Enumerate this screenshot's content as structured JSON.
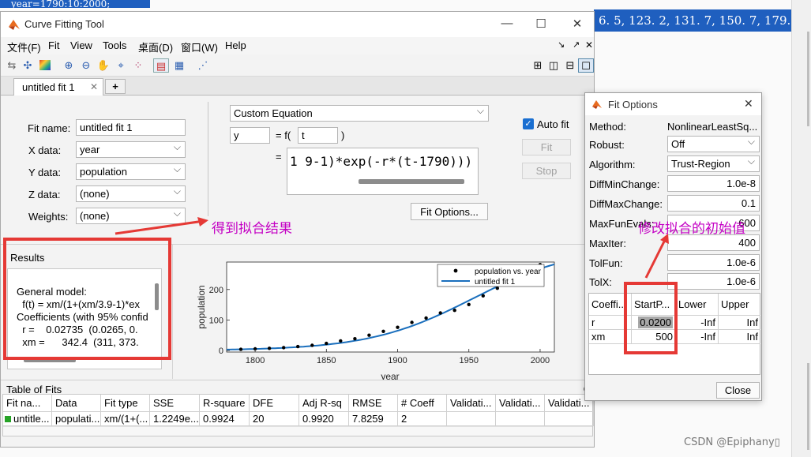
{
  "background": {
    "line1": "year=1790:10:2000;",
    "line2": "6. 5, 123. 2, 131. 7, 150. 7, 179."
  },
  "window": {
    "title": "Curve Fitting Tool",
    "menu": [
      "文件(F)",
      "Fit",
      "View",
      "Tools",
      "桌面(D)",
      "窗口(W)",
      "Help"
    ],
    "tab_label": "untitled fit 1",
    "tab_add": "+"
  },
  "fit_form": {
    "fit_name_label": "Fit name:",
    "fit_name_value": "untitled fit 1",
    "x_label": "X data:",
    "x_value": "year",
    "y_label": "Y data:",
    "y_value": "population",
    "z_label": "Z data:",
    "z_value": "(none)",
    "w_label": "Weights:",
    "w_value": "(none)"
  },
  "equation": {
    "type": "Custom Equation",
    "lhs": "y",
    "eq_sign": "= f(",
    "var": "t",
    "close": ")",
    "eq2": "=",
    "expr": "1 9-1)*exp(-r*(t-1790)))",
    "auto_fit": "Auto fit",
    "fit_btn": "Fit",
    "stop_btn": "Stop",
    "fit_options_btn": "Fit Options..."
  },
  "results": {
    "header": "Results",
    "lines": [
      "General model:",
      "  f(t) = xm/(1+(xm/3.9-1)*ex",
      "Coefficients (with 95% confid",
      "  r =    0.02735  (0.0265, 0.",
      "  xm =      342.4  (311, 373."
    ]
  },
  "chart_data": {
    "type": "scatter",
    "x": [
      1790,
      1800,
      1810,
      1820,
      1830,
      1840,
      1850,
      1860,
      1870,
      1880,
      1890,
      1900,
      1910,
      1920,
      1930,
      1940,
      1950,
      1960,
      1970,
      1980,
      1990,
      2000
    ],
    "series": [
      {
        "name": "population vs. year",
        "values": [
          3.9,
          5.3,
          7.2,
          9.6,
          12.9,
          17.1,
          23.2,
          31.4,
          38.6,
          50.2,
          62.9,
          76.0,
          92.0,
          106.5,
          123.2,
          131.7,
          150.7,
          179.3,
          204.0,
          226.5,
          251.4,
          281.4
        ]
      },
      {
        "name": "untitled fit 1",
        "model": "xm/(1+(xm/3.9-1)*exp(-r*(t-1790)))",
        "r": 0.02735,
        "xm": 342.4
      }
    ],
    "xlabel": "year",
    "ylabel": "population",
    "xticks": [
      1800,
      1850,
      1900,
      1950,
      2000
    ],
    "yticks": [
      0,
      100,
      200
    ],
    "xlim": [
      1780,
      2010
    ],
    "ylim": [
      -5,
      290
    ],
    "legend": "top-right"
  },
  "table_of_fits": {
    "title": "Table of Fits",
    "columns": [
      "Fit na...",
      "Data",
      "Fit type",
      "SSE",
      "R-square",
      "DFE",
      "Adj R-sq",
      "RMSE",
      "# Coeff",
      "Validati...",
      "Validati...",
      "Validati..."
    ],
    "row": [
      "untitle...",
      "populati...",
      "xm/(1+(...",
      "1.2249e...",
      "0.9924",
      "20",
      "0.9920",
      "7.8259",
      "2",
      "",
      "",
      ""
    ],
    "status_color": "#27a327"
  },
  "fit_options": {
    "title": "Fit Options",
    "method_label": "Method:",
    "method_value": "NonlinearLeastSq...",
    "robust_label": "Robust:",
    "robust_value": "Off",
    "algorithm_label": "Algorithm:",
    "algorithm_value": "Trust-Region",
    "diffmin_label": "DiffMinChange:",
    "diffmin_value": "1.0e-8",
    "diffmax_label": "DiffMaxChange:",
    "diffmax_value": "0.1",
    "maxfun_label": "MaxFunEvals:",
    "maxfun_value": "600",
    "maxiter_label": "MaxIter:",
    "maxiter_value": "400",
    "tolfun_label": "TolFun:",
    "tolfun_value": "1.0e-6",
    "tolx_label": "TolX:",
    "tolx_value": "1.0e-6",
    "grid_headers": [
      "Coeffi...",
      "StartP...",
      "Lower",
      "Upper"
    ],
    "grid_rows": [
      [
        "r",
        "0.0200",
        "-Inf",
        "Inf"
      ],
      [
        "xm",
        "500",
        "-Inf",
        "Inf"
      ]
    ],
    "close_btn": "Close"
  },
  "annotations": {
    "result_note": "得到拟合结果",
    "start_note": "修改拟合的初始值",
    "color": "#c400c4"
  },
  "watermark": "CSDN @Epiphany▯"
}
